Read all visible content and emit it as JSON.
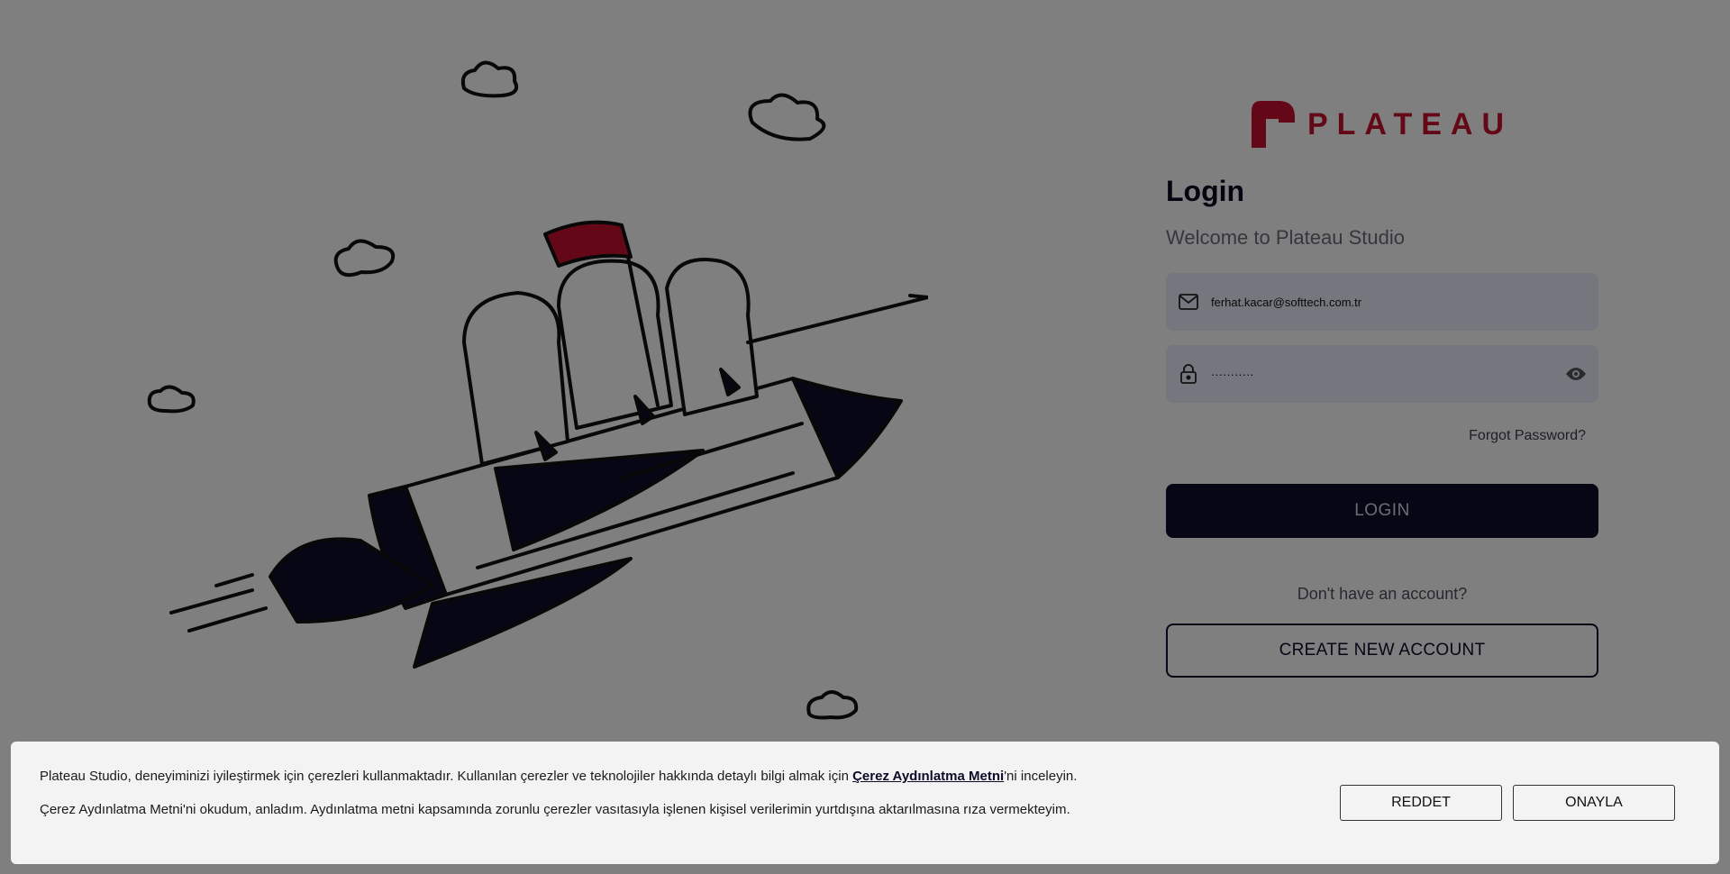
{
  "brand": {
    "name": "PLATEAU",
    "color": "#c8102e"
  },
  "login": {
    "title": "Login",
    "welcome": "Welcome to Plateau Studio",
    "email_icon": "mail-icon",
    "email_value": "ferhat.kacar@softtech.com.tr",
    "password_icon": "lock-icon",
    "password_value": "···········",
    "toggle_icon": "eye-icon",
    "forgot_label": "Forgot Password?",
    "login_label": "LOGIN",
    "no_account_text": "Don't have an account?",
    "create_label": "CREATE NEW ACCOUNT"
  },
  "cookie_banner": {
    "line1_before": "Plateau Studio, deneyiminizi iyileştirmek için çerezleri kullanmaktadır. Kullanılan çerezler ve teknolojiler hakkında detaylı bilgi almak için ",
    "line1_link": "Çerez Aydınlatma Metni",
    "line1_after": "'ni inceleyin.",
    "line2": "Çerez Aydınlatma Metni'ni okudum, anladım. Aydınlatma metni kapsamında zorunlu çerezler vasıtasıyla işlenen kişisel verilerimin yurtdışına aktarılmasına rıza vermekteyim.",
    "reject_label": "REDDET",
    "accept_label": "ONAYLA"
  },
  "colors": {
    "overlay": "rgba(0,0,0,0.5)",
    "primary_dark": "#0c0c2a",
    "field_bg": "#e8eefb"
  }
}
